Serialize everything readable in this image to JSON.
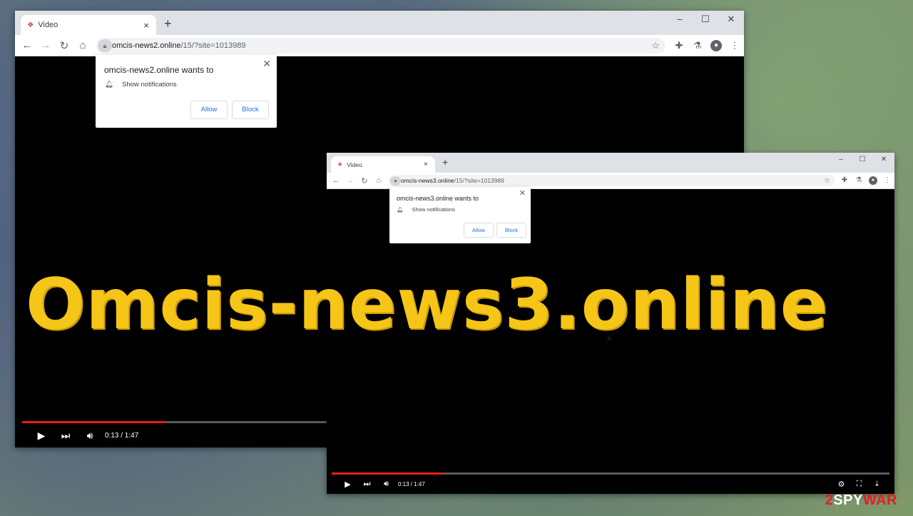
{
  "window1": {
    "tab_title": "Video",
    "tab_favicon": "video-favicon",
    "url_host": "omcis-news2.online",
    "url_path": "/15/?site=1013989",
    "popup": {
      "title": "omcis-news2.online wants to",
      "permission": "Show notifications",
      "allow": "Allow",
      "block": "Block"
    },
    "player": {
      "time": "0:13 / 1:47",
      "progress_fraction": 0.2
    }
  },
  "window2": {
    "tab_title": "Video",
    "url_host": "omcis-news3.online",
    "url_path": "/15/?site=1013989",
    "popup": {
      "title": "omcis-news3.online wants to",
      "permission": "Show notifications",
      "allow": "Allow",
      "block": "Block"
    },
    "player": {
      "time": "0:13 / 1:47",
      "progress_fraction": 0.2
    }
  },
  "overlay_title": "Omcis-news3.online",
  "watermark": {
    "prefix": "2",
    "middle": "SPY",
    "suffix": "WAR"
  },
  "colors": {
    "accent_title": "#f5c518",
    "progress": "#e62117",
    "link_blue": "#1a73e8"
  }
}
